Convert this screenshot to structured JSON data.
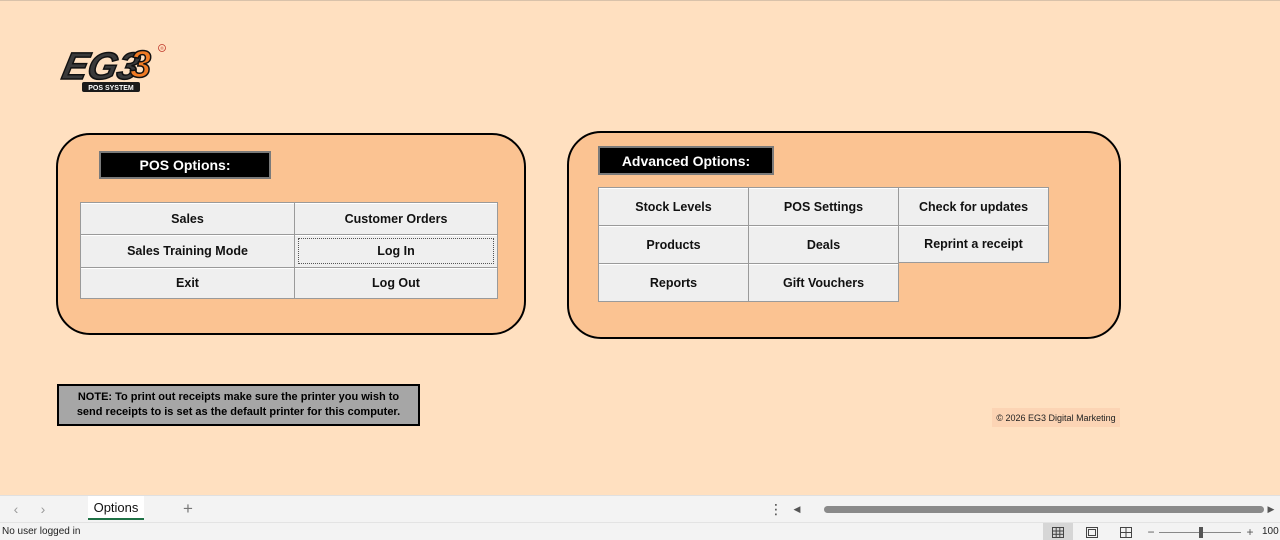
{
  "logo": {
    "text": "EG3",
    "subtitle": "POS SYSTEM",
    "mark": "®"
  },
  "pos_options": {
    "title": "POS Options:",
    "buttons": [
      "Sales",
      "Customer Orders",
      "Sales Training Mode",
      "Log In",
      "Exit",
      "Log Out"
    ]
  },
  "advanced_options": {
    "title": "Advanced Options:",
    "buttons": [
      "Stock Levels",
      "POS Settings",
      "Check for updates",
      "Products",
      "Deals",
      "Reprint a receipt",
      "Reports",
      "Gift Vouchers"
    ]
  },
  "note": "NOTE: To print out receipts make sure the printer you wish to send receipts to is set as the default printer for this computer.",
  "copyright": "© 2026 EG3 Digital Marketing",
  "tabbar": {
    "active_tab": "Options",
    "add_symbol": "+",
    "more_symbol": "⋮"
  },
  "statusbar": {
    "status": "No user logged in",
    "zoom": "100"
  },
  "colors": {
    "background": "#ffe0c0",
    "panel": "#fbc392",
    "button": "#efefef",
    "note": "#a6a6a6",
    "logo_orange": "#f07b24",
    "logo_dark": "#3a3a3a"
  }
}
